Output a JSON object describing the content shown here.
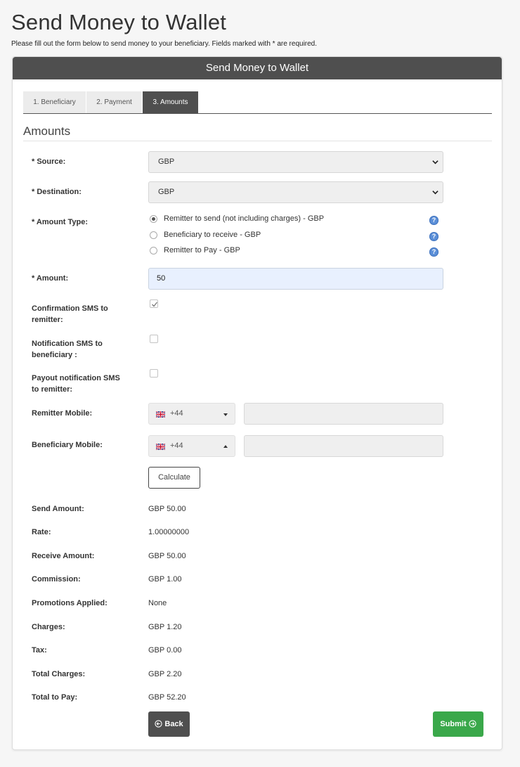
{
  "page": {
    "title": "Send Money to Wallet",
    "subtitle": "Please fill out the form below to send money to your beneficiary. Fields marked with * are required."
  },
  "panel": {
    "header": "Send Money to Wallet",
    "tabs": [
      {
        "label": "1. Beneficiary",
        "active": false
      },
      {
        "label": "2. Payment",
        "active": false
      },
      {
        "label": "3. Amounts",
        "active": true
      }
    ],
    "section_title": "Amounts"
  },
  "form": {
    "source": {
      "label": "* Source:",
      "value": "GBP"
    },
    "destination": {
      "label": "* Destination:",
      "value": "GBP"
    },
    "amount_type": {
      "label": "* Amount Type:",
      "options": [
        {
          "label": "Remitter to send (not including charges) - GBP",
          "checked": true
        },
        {
          "label": "Beneficiary to receive - GBP",
          "checked": false
        },
        {
          "label": "Remitter to Pay - GBP",
          "checked": false
        }
      ]
    },
    "amount": {
      "label": "* Amount:",
      "value": "50"
    },
    "confirmation_sms": {
      "label_line1": "Confirmation SMS to",
      "label_line2": "remitter:",
      "checked": true
    },
    "notification_sms": {
      "label_line1": "Notification SMS to",
      "label_line2": "beneficiary :",
      "checked": false
    },
    "payout_sms": {
      "label_line1": "Payout notification SMS",
      "label_line2": "to remitter:",
      "checked": false
    },
    "remitter_mobile": {
      "label": "Remitter Mobile:",
      "code": "+44",
      "number": ""
    },
    "beneficiary_mobile": {
      "label": "Beneficiary Mobile:",
      "code": "+44",
      "number": ""
    },
    "calculate_label": "Calculate"
  },
  "summary": [
    {
      "label": "Send Amount:",
      "value": "GBP 50.00"
    },
    {
      "label": "Rate:",
      "value": "1.00000000"
    },
    {
      "label": "Receive Amount:",
      "value": "GBP 50.00"
    },
    {
      "label": "Commission:",
      "value": "GBP 1.00"
    },
    {
      "label": "Promotions Applied:",
      "value": "None"
    },
    {
      "label": "Charges:",
      "value": "GBP 1.20"
    },
    {
      "label": "Tax:",
      "value": "GBP 0.00"
    },
    {
      "label": "Total Charges:",
      "value": "GBP 2.20"
    },
    {
      "label": "Total to Pay:",
      "value": "GBP 52.20"
    }
  ],
  "actions": {
    "back_label": "Back",
    "submit_label": "Submit"
  },
  "colors": {
    "header": "#4f4f4f",
    "submit": "#3aa84a",
    "amount_bg": "#e8f0fe",
    "help_icon": "#5b8fd8"
  },
  "icons": {
    "select_chevron": "chevron-down-icon",
    "help": "question-circle-icon",
    "back": "arrow-left-circle-icon",
    "submit": "arrow-right-circle-icon",
    "flag": "uk-flag-icon"
  }
}
